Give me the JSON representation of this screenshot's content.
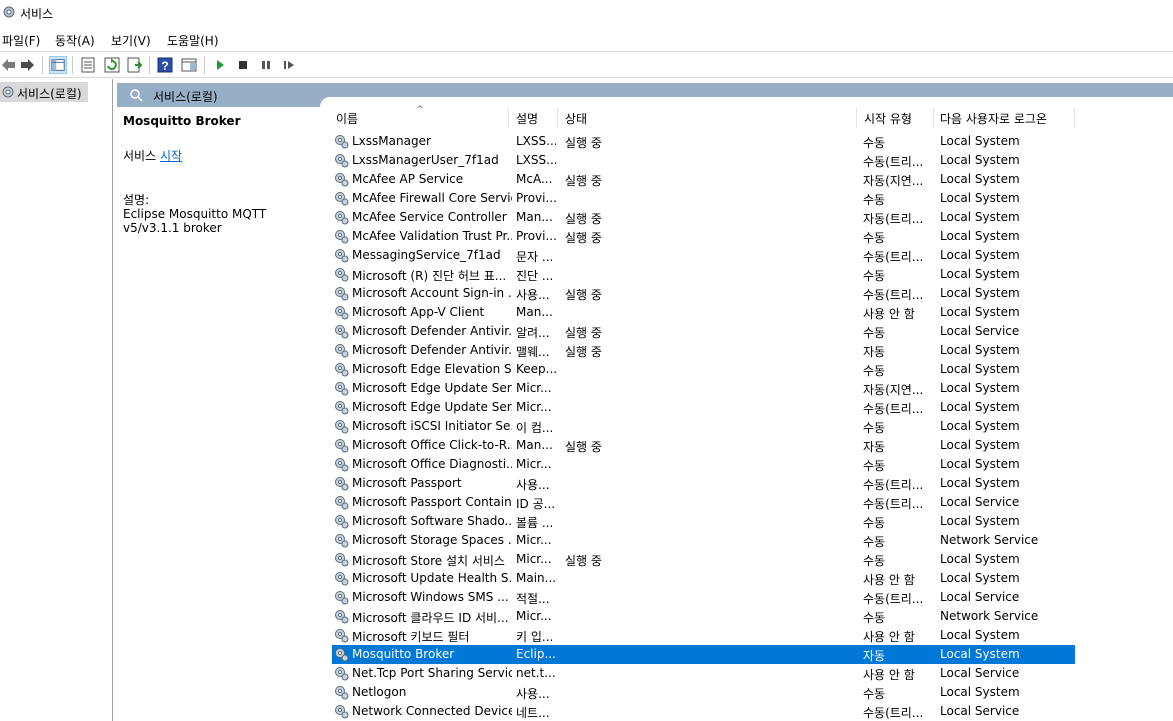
{
  "window": {
    "title": "서비스"
  },
  "menu": [
    "파일(F)",
    "동작(A)",
    "보기(V)",
    "도움말(H)"
  ],
  "toolbar": {
    "buttons": [
      "back-arrow-icon",
      "forward-arrow-icon",
      "show-hide-tree-icon",
      "properties-icon",
      "refresh-icon",
      "export-list-icon",
      "help-icon",
      "action-pane-icon",
      "play-icon",
      "stop-icon",
      "pause-icon",
      "resume-icon"
    ]
  },
  "tree": {
    "root_label": "서비스(로컬)"
  },
  "header": {
    "title": "서비스(로컬)"
  },
  "description": {
    "service_name": "Mosquitto Broker",
    "start_prefix": "서비스",
    "start_link": "시작",
    "desc_label": "설명:",
    "desc_text": "Eclipse Mosquitto MQTT v5/v3.1.1 broker"
  },
  "columns": {
    "name": "이름",
    "desc": "설명",
    "status": "상태",
    "start": "시작 유형",
    "logon": "다음 사용자로 로그온"
  },
  "services": [
    {
      "name": "LxssManager",
      "desc": "LXSS...",
      "status": "실행 중",
      "start": "수동",
      "logon": "Local System"
    },
    {
      "name": "LxssManagerUser_7f1ad",
      "desc": "LXSS...",
      "status": "",
      "start": "수동(트리...",
      "logon": "Local System"
    },
    {
      "name": "McAfee AP Service",
      "desc": "McA...",
      "status": "실행 중",
      "start": "자동(지연...",
      "logon": "Local System"
    },
    {
      "name": "McAfee Firewall Core Service",
      "desc": "Provi...",
      "status": "",
      "start": "수동",
      "logon": "Local System"
    },
    {
      "name": "McAfee Service Controller",
      "desc": "Man...",
      "status": "실행 중",
      "start": "자동(트리...",
      "logon": "Local System"
    },
    {
      "name": "McAfee Validation Trust Pr...",
      "desc": "Provi...",
      "status": "실행 중",
      "start": "수동",
      "logon": "Local System"
    },
    {
      "name": "MessagingService_7f1ad",
      "desc": "문자 ...",
      "status": "",
      "start": "수동(트리...",
      "logon": "Local System"
    },
    {
      "name": "Microsoft (R) 진단 허브 표...",
      "desc": "진단 ...",
      "status": "",
      "start": "수동",
      "logon": "Local System"
    },
    {
      "name": "Microsoft Account Sign-in ...",
      "desc": "사용...",
      "status": "실행 중",
      "start": "수동(트리...",
      "logon": "Local System"
    },
    {
      "name": "Microsoft App-V Client",
      "desc": "Man...",
      "status": "",
      "start": "사용 안 함",
      "logon": "Local System"
    },
    {
      "name": "Microsoft Defender Antivir...",
      "desc": "알려...",
      "status": "실행 중",
      "start": "수동",
      "logon": "Local Service"
    },
    {
      "name": "Microsoft Defender Antivir...",
      "desc": "맬웨...",
      "status": "실행 중",
      "start": "자동",
      "logon": "Local System"
    },
    {
      "name": "Microsoft Edge Elevation S...",
      "desc": "Keep...",
      "status": "",
      "start": "수동",
      "logon": "Local System"
    },
    {
      "name": "Microsoft Edge Update Ser...",
      "desc": "Micr...",
      "status": "",
      "start": "자동(지연...",
      "logon": "Local System"
    },
    {
      "name": "Microsoft Edge Update Ser...",
      "desc": "Micr...",
      "status": "",
      "start": "수동(트리...",
      "logon": "Local System"
    },
    {
      "name": "Microsoft iSCSI Initiator Se...",
      "desc": "이 컴...",
      "status": "",
      "start": "수동",
      "logon": "Local System"
    },
    {
      "name": "Microsoft Office Click-to-R...",
      "desc": "Man...",
      "status": "실행 중",
      "start": "자동",
      "logon": "Local System"
    },
    {
      "name": "Microsoft Office Diagnosti...",
      "desc": "Micr...",
      "status": "",
      "start": "수동",
      "logon": "Local System"
    },
    {
      "name": "Microsoft Passport",
      "desc": "사용...",
      "status": "",
      "start": "수동(트리...",
      "logon": "Local System"
    },
    {
      "name": "Microsoft Passport Container",
      "desc": "ID 공...",
      "status": "",
      "start": "수동(트리...",
      "logon": "Local Service"
    },
    {
      "name": "Microsoft Software Shado...",
      "desc": "볼륨 ...",
      "status": "",
      "start": "수동",
      "logon": "Local System"
    },
    {
      "name": "Microsoft Storage Spaces ...",
      "desc": "Micr...",
      "status": "",
      "start": "수동",
      "logon": "Network Service"
    },
    {
      "name": "Microsoft Store 설치 서비스",
      "desc": "Micr...",
      "status": "실행 중",
      "start": "수동",
      "logon": "Local System"
    },
    {
      "name": "Microsoft Update Health S...",
      "desc": "Main...",
      "status": "",
      "start": "사용 안 함",
      "logon": "Local System"
    },
    {
      "name": "Microsoft Windows SMS ...",
      "desc": "적절...",
      "status": "",
      "start": "수동(트리...",
      "logon": "Local Service"
    },
    {
      "name": "Microsoft 클라우드 ID 서비...",
      "desc": "Micr...",
      "status": "",
      "start": "수동",
      "logon": "Network Service"
    },
    {
      "name": "Microsoft 키보드 필터",
      "desc": "키 입...",
      "status": "",
      "start": "사용 안 함",
      "logon": "Local System"
    },
    {
      "name": "Mosquitto Broker",
      "desc": "Eclip...",
      "status": "",
      "start": "자동",
      "logon": "Local System",
      "selected": true
    },
    {
      "name": "Net.Tcp Port Sharing Service",
      "desc": "net.t...",
      "status": "",
      "start": "사용 안 함",
      "logon": "Local Service"
    },
    {
      "name": "Netlogon",
      "desc": "사용...",
      "status": "",
      "start": "수동",
      "logon": "Local System"
    },
    {
      "name": "Network Connected Device...",
      "desc": "네트...",
      "status": "",
      "start": "수동(트리...",
      "logon": "Local Service"
    }
  ],
  "colors": {
    "header_bar": "#97aec7",
    "selection": "#0078d7",
    "link": "#0066cc"
  }
}
